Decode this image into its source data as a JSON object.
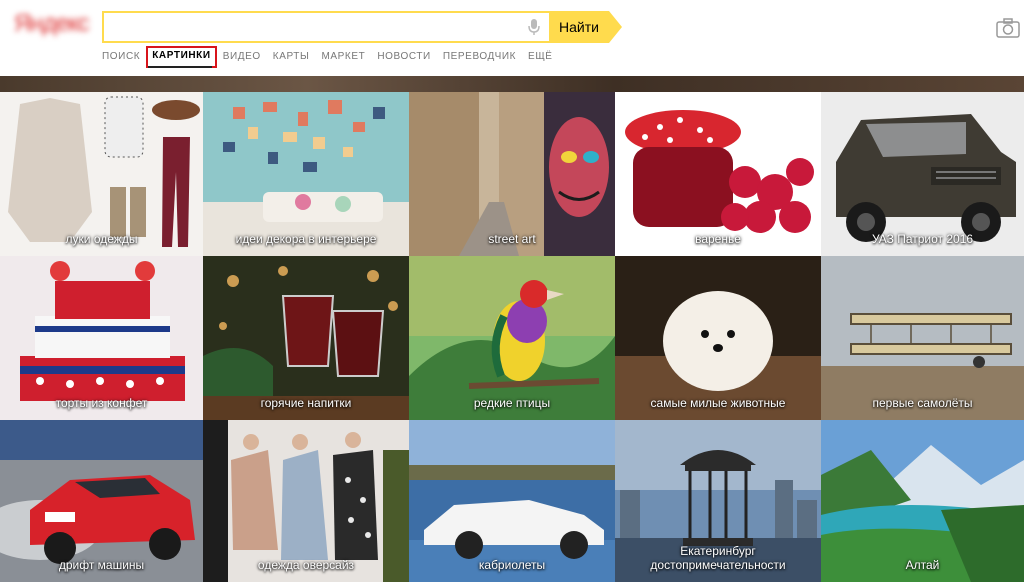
{
  "header": {
    "logo_text": "Яндекс",
    "search": {
      "value": "",
      "placeholder": ""
    },
    "find_label": "Найти",
    "accent": "#ffdb4d"
  },
  "nav": {
    "items": [
      {
        "label": "ПОИСК",
        "active": false
      },
      {
        "label": "КАРТИНКИ",
        "active": true
      },
      {
        "label": "ВИДЕО",
        "active": false
      },
      {
        "label": "КАРТЫ",
        "active": false
      },
      {
        "label": "МАРКЕТ",
        "active": false
      },
      {
        "label": "НОВОСТИ",
        "active": false
      },
      {
        "label": "ПЕРЕВОДЧИК",
        "active": false
      },
      {
        "label": "ЕЩЁ",
        "active": false
      }
    ],
    "highlight_color": "#d8141b"
  },
  "tiles": [
    {
      "label": "луки одежды",
      "icon": "clothing-image"
    },
    {
      "label": "идеи декора в интерьере",
      "icon": "interior-decor-image"
    },
    {
      "label": "street art",
      "icon": "street-art-image"
    },
    {
      "label": "варенье",
      "icon": "jam-image"
    },
    {
      "label": "УАЗ Патриот 2016",
      "icon": "suv-image"
    },
    {
      "label": "торты из конфет",
      "icon": "candy-cake-image"
    },
    {
      "label": "горячие напитки",
      "icon": "hot-drinks-image"
    },
    {
      "label": "редкие птицы",
      "icon": "rare-bird-image"
    },
    {
      "label": "самые милые животные",
      "icon": "cute-puppy-image"
    },
    {
      "label": "первые самолёты",
      "icon": "vintage-airplane-image"
    },
    {
      "label": "дрифт машины",
      "icon": "drift-car-image"
    },
    {
      "label": "одежда оверсайз",
      "icon": "oversize-fashion-image"
    },
    {
      "label": "кабриолеты",
      "icon": "convertible-image"
    },
    {
      "label_line1": "Екатеринбург",
      "label_line2": "достопримечательности",
      "icon": "gazebo-image"
    },
    {
      "label": "Алтай",
      "icon": "mountains-image"
    }
  ]
}
